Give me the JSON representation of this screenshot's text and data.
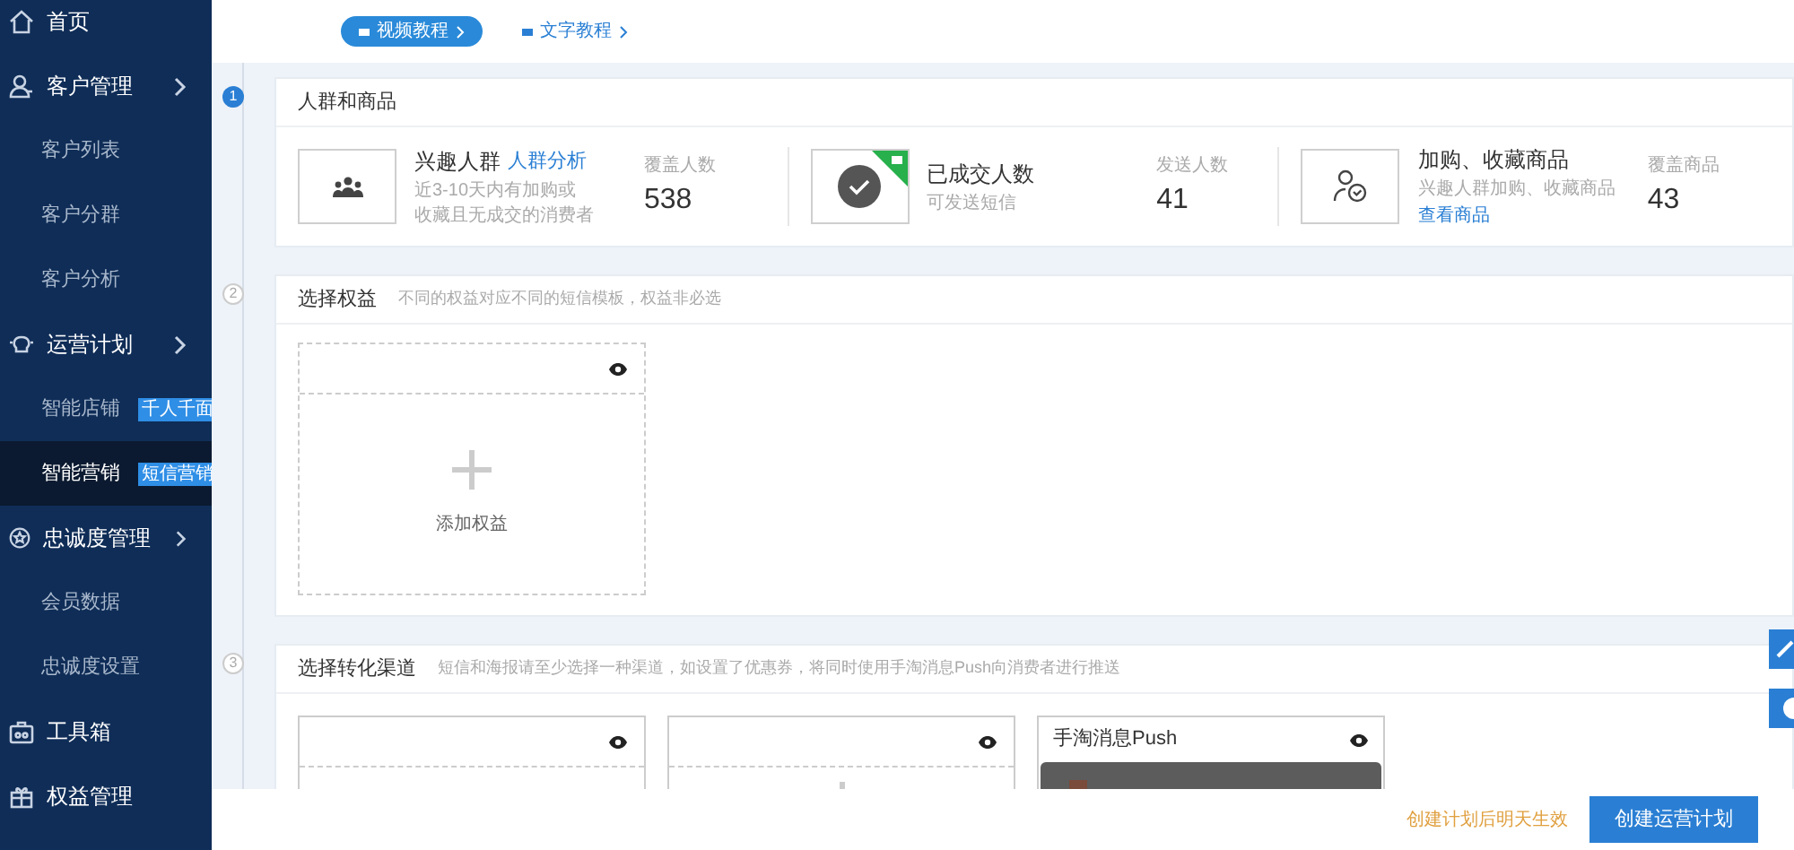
{
  "sidebar": {
    "items": [
      {
        "label": "首页",
        "selected": false
      },
      {
        "label": "客户管理",
        "selected": false,
        "children": [
          {
            "label": "客户列表",
            "selected": false
          },
          {
            "label": "客户分群",
            "selected": false
          },
          {
            "label": "客户分析",
            "selected": false
          }
        ]
      },
      {
        "label": "运营计划",
        "selected": false,
        "children": [
          {
            "label": "智能店铺",
            "badge": "千人千面",
            "selected": false
          },
          {
            "label": "智能营销",
            "badge": "短信营销",
            "selected": true
          }
        ]
      },
      {
        "label": "忠诚度管理",
        "selected": false,
        "children": [
          {
            "label": "会员数据",
            "selected": false
          },
          {
            "label": "忠诚度设置",
            "selected": false
          }
        ]
      },
      {
        "label": "工具箱",
        "selected": false
      },
      {
        "label": "权益管理",
        "selected": false
      }
    ]
  },
  "tutorials": [
    {
      "label": "视频教程",
      "primary": true
    },
    {
      "label": "文字教程",
      "primary": false
    }
  ],
  "steps": [
    {
      "number": "1",
      "active": true,
      "title": "人群和商品",
      "kind": "audience",
      "items": [
        {
          "title": "兴趣人群",
          "title_link": "人群分析",
          "description": [
            "近3-10天内有加购或",
            "收藏且无成交的消费者"
          ],
          "stat_label": "覆盖人数",
          "stat_value": "538",
          "flag": false
        },
        {
          "title": "已成交人数",
          "description": [
            "可发送短信"
          ],
          "stat_label": "发送人数",
          "stat_value": "41",
          "flag": true
        },
        {
          "title": "加购、收藏商品",
          "description": [
            "兴趣人群加购、收藏商品"
          ],
          "link": "查看商品",
          "stat_label": "覆盖商品",
          "stat_value": "43",
          "flag": false
        }
      ]
    },
    {
      "number": "2",
      "active": false,
      "title": "选择权益",
      "hint": "不同的权益对应不同的短信模板，权益非必选",
      "kind": "benefits",
      "cards": [
        {
          "label": "添加权益"
        }
      ]
    },
    {
      "number": "3",
      "active": false,
      "title": "选择转化渠道",
      "hint": "短信和海报请至少选择一种渠道，如设置了优惠券，将同时使用手淘消息Push向消费者进行推送",
      "kind": "channels",
      "cards": [
        {
          "kind": "empty"
        },
        {
          "kind": "add"
        },
        {
          "kind": "push",
          "title": "手淘消息Push"
        }
      ]
    }
  ],
  "footer": {
    "note": "创建计划后明天生效",
    "button": "创建运营计划"
  }
}
